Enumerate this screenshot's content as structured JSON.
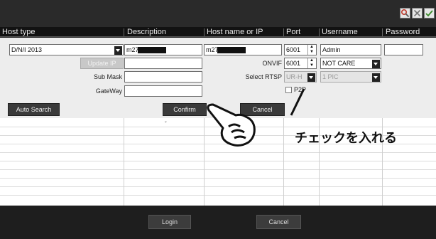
{
  "columns": [
    "Host type",
    "Description",
    "Host name or IP",
    "Port",
    "Username",
    "Password"
  ],
  "toolbar": {
    "icons": [
      "search-icon",
      "close-icon",
      "check-icon"
    ]
  },
  "form": {
    "host_type": "D/N/I 2013",
    "description_prefix": "m27",
    "host_prefix": "m27",
    "port": "6001",
    "username": "Admin",
    "update_ip_label": "Update IP",
    "onvif_label": "ONVIF",
    "onvif_port": "6001",
    "onvif_mode": "NOT CARE",
    "sub_mask_label": "Sub Mask",
    "select_rtsp_label": "Select RTSP",
    "rtsp_stream": "UR-H",
    "rtsp_pic": "1 PIC",
    "gateway_label": "GateWay",
    "p2p_label": "P2P",
    "auto_search_label": "Auto Search",
    "confirm_label": "Confirm",
    "cancel_label": "Cancel"
  },
  "annotation": {
    "text": "チェックを入れる"
  },
  "footer": {
    "login_label": "Login",
    "cancel_label": "Cancel"
  }
}
